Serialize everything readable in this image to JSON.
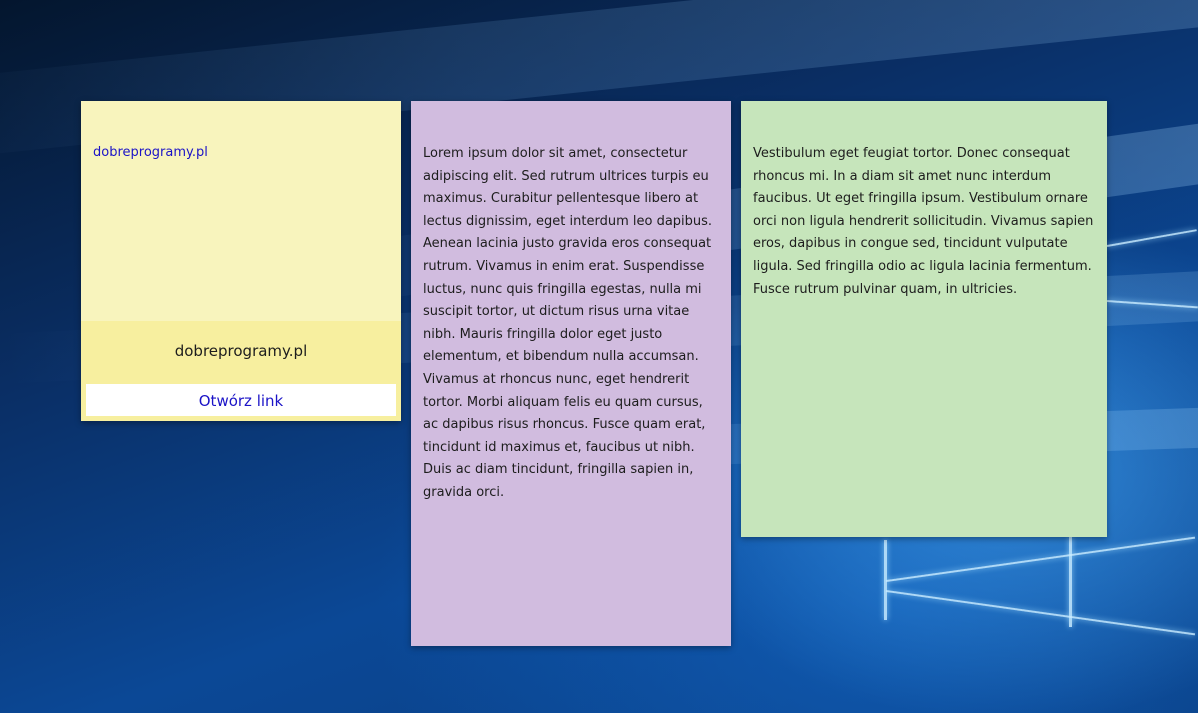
{
  "desktop": {
    "wallpaper": "windows-10-hero",
    "colors": {
      "wallpaper_dark": "#04162e",
      "wallpaper_mid": "#0b4896",
      "wallpaper_glow": "#50b4ff"
    }
  },
  "notes": [
    {
      "color": "#f8f4bd",
      "link_text": "dobreprogramy.pl",
      "preview": {
        "color": "#f7ef9f",
        "title": "dobreprogramy.pl",
        "button_label": "Otwórz link"
      }
    },
    {
      "color": "#d1bcdf",
      "text": "Lorem ipsum dolor sit amet, consectetur adipiscing elit. Sed rutrum ultrices turpis eu maximus. Curabitur pellentesque libero at lectus dignissim, eget interdum leo dapibus. Aenean lacinia justo gravida eros consequat rutrum. Vivamus in enim erat. Suspendisse luctus, nunc quis fringilla egestas, nulla mi suscipit tortor, ut dictum risus urna vitae nibh. Mauris fringilla dolor eget justo elementum, et bibendum nulla accumsan. Vivamus at rhoncus nunc, eget hendrerit tortor. Morbi aliquam felis eu quam cursus, ac dapibus risus rhoncus. Fusce quam erat, tincidunt id maximus et, faucibus ut nibh. Duis ac diam tincidunt, fringilla sapien in, gravida orci."
    },
    {
      "color": "#c6e5bb",
      "text": "Vestibulum eget feugiat tortor. Donec consequat rhoncus mi. In a diam sit amet nunc interdum faucibus. Ut eget fringilla ipsum. Vestibulum ornare orci non ligula hendrerit sollicitudin. Vivamus sapien eros, dapibus in congue sed, tincidunt vulputate ligula. Sed fringilla odio ac ligula lacinia fermentum. Fusce rutrum pulvinar quam, in ultricies."
    }
  ]
}
